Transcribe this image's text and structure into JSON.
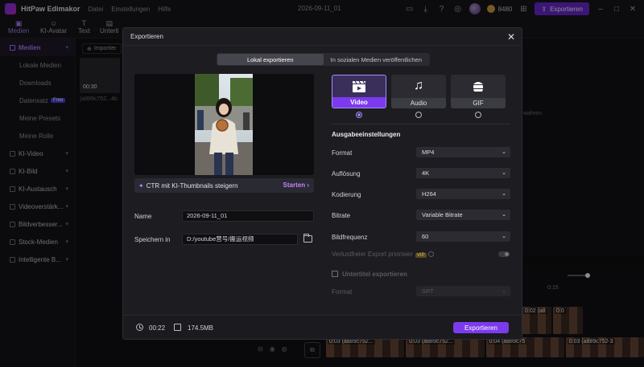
{
  "app": {
    "name": "HitPaw Edimakor",
    "menu": [
      "Datei",
      "Einstellungen",
      "Hilfe"
    ],
    "doc_title": "2026-09-11_01",
    "credits": "8480",
    "export_label": "Exportieren"
  },
  "toolbar": {
    "items": [
      {
        "label": "Medien",
        "icon": "media-icon"
      },
      {
        "label": "KI-Avatar",
        "icon": "avatar-icon"
      },
      {
        "label": "Text",
        "icon": "text-icon"
      },
      {
        "label": "Unterti",
        "icon": "subtitle-icon"
      }
    ]
  },
  "sidebar": {
    "items": [
      {
        "label": "Medien",
        "type": "head"
      },
      {
        "label": "Lokale Medien",
        "type": "sub"
      },
      {
        "label": "Downloads",
        "type": "sub"
      },
      {
        "label": "Datensatz",
        "type": "sub",
        "badge": "Free"
      },
      {
        "label": "Meine Presets",
        "type": "sub"
      },
      {
        "label": "Meine Rolle",
        "type": "sub"
      },
      {
        "label": "KI-Video",
        "type": "group"
      },
      {
        "label": "KI-Bild",
        "type": "group"
      },
      {
        "label": "KI-Austausch",
        "type": "group"
      },
      {
        "label": "Videoverstärk...",
        "type": "group"
      },
      {
        "label": "Bildverbesser...",
        "type": "group"
      },
      {
        "label": "Stock-Medien",
        "type": "group"
      },
      {
        "label": "Intelligente B...",
        "type": "group"
      }
    ]
  },
  "media": {
    "import_label": "Importier",
    "clip_duration": "00:30",
    "clip_name": "(a889c752...4b"
  },
  "behind": {
    "prop_text": "wahren",
    "ruler_mark": "0:15",
    "clips": [
      "0:03 (a889c752...",
      "0:03 (a889c752...",
      "0:04 (a889c75",
      "0:03 (a889c752-3"
    ],
    "clips2": [
      "0:02 (a8",
      "0:0"
    ]
  },
  "modal": {
    "title": "Exportieren",
    "tabs": [
      "Lokal exportieren",
      "In sozialen Medien veröffentlichen"
    ],
    "ctr_text": "CTR mit KI-Thumbnails steigern",
    "ctr_action": "Starten",
    "name_label": "Name",
    "name_value": "2026-09-11_01",
    "save_label": "Speichern in",
    "save_path": "D:/youtube营号/搬运视频",
    "types": [
      "Video",
      "Audio",
      "GIF"
    ],
    "section_title": "Ausgabeeinstellungen",
    "settings": [
      {
        "label": "Format",
        "value": "MP4"
      },
      {
        "label": "Auflösung",
        "value": "4K"
      },
      {
        "label": "Kodierung",
        "value": "H264"
      },
      {
        "label": "Bitrate",
        "value": "Variable Bitrate"
      },
      {
        "label": "Bildfrequenz",
        "value": "60"
      }
    ],
    "lossless_label": "Verlustfreier Export priorisier",
    "vip_badge": "VIP",
    "subtitle_export_label": "Untertitel exportieren",
    "subtitle_format_label": "Format",
    "subtitle_format_value": "SRT",
    "duration": "00:22",
    "filesize": "174.5MB",
    "export_button": "Exportieren"
  },
  "colors": {
    "accent": "#7c3aed",
    "accent_light": "#a78bfa",
    "modal_bg": "#1c1c21"
  }
}
